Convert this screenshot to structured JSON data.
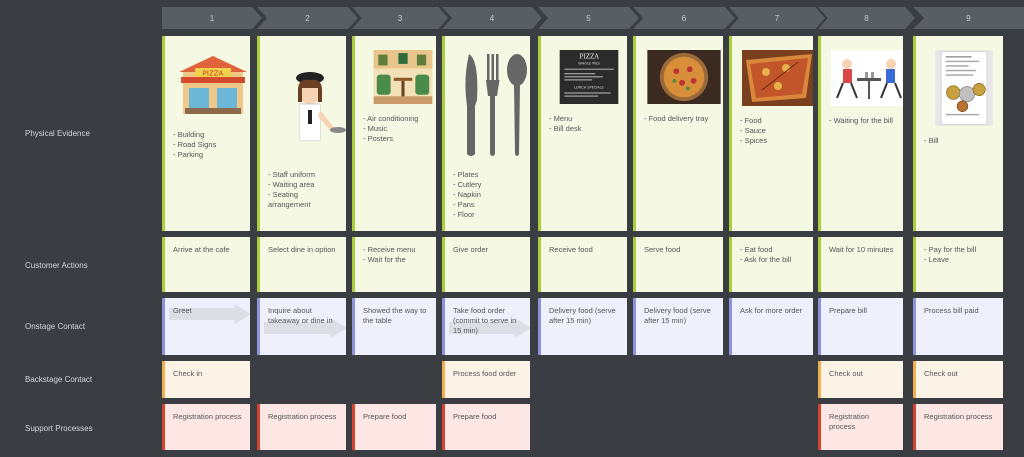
{
  "steps": [
    "1",
    "2",
    "3",
    "4",
    "5",
    "6",
    "7",
    "8",
    "9"
  ],
  "rows": {
    "physical_evidence": "Physical Evidence",
    "customer_actions": "Customer Actions",
    "onstage_contact": "Onstage Contact",
    "backstage_contact": "Backstage Contact",
    "support_processes": "Support Processes"
  },
  "physical_evidence": [
    {
      "image": "pizza-shop-building",
      "text": "- Building\n- Road Signs\n- Parking"
    },
    {
      "image": "waitress-staff",
      "text": "- Staff uniform\n- Waiting area\n- Seating arrangement"
    },
    {
      "image": "restaurant-interior",
      "text": "- Air conditioning\n- Music\n- Posters"
    },
    {
      "image": "cutlery-knife-fork-spoon",
      "text": "- Plates\n- Cutlery\n- Napkin\n- Pans\n- Floor"
    },
    {
      "image": "pizza-menu-board",
      "text": "- Menu\n- Bill desk"
    },
    {
      "image": "pizza-on-tray",
      "text": "- Food delivery tray"
    },
    {
      "image": "pizza-slice-closeup",
      "text": "- Food\n- Sauce\n- Spices"
    },
    {
      "image": "diners-at-table",
      "text": "- Waiting for the bill"
    },
    {
      "image": "bill-with-coins",
      "text": "- Bill"
    }
  ],
  "customer_actions": [
    "Arrive at the cafe",
    "Select dine in option",
    "- Receive menu\n- Wait for the",
    "Give order",
    "Receive food",
    "Serve food",
    "- Eat food\n- Ask for the bill",
    "Wait for 10 minutes",
    "- Pay for the bill\n- Leave"
  ],
  "onstage_contact": [
    "Greet",
    "Inquire about takeaway or dine in",
    "Showed the way to the table",
    "Take food order (commit to serve in 15 min)",
    "Delivery food (serve after 15 min)",
    "Delivery food (serve after 15 min)",
    "Ask for more order",
    "Prepare bill",
    "Process bill paid"
  ],
  "backstage_contact": [
    "Check in",
    "",
    "",
    "Process food order",
    "",
    "",
    "",
    "Check out",
    "Check out"
  ],
  "support_processes": [
    "Registration process",
    "Registration process",
    "Prepare food",
    "Prepare food",
    "",
    "",
    "",
    "Registration process",
    "Registration process"
  ]
}
